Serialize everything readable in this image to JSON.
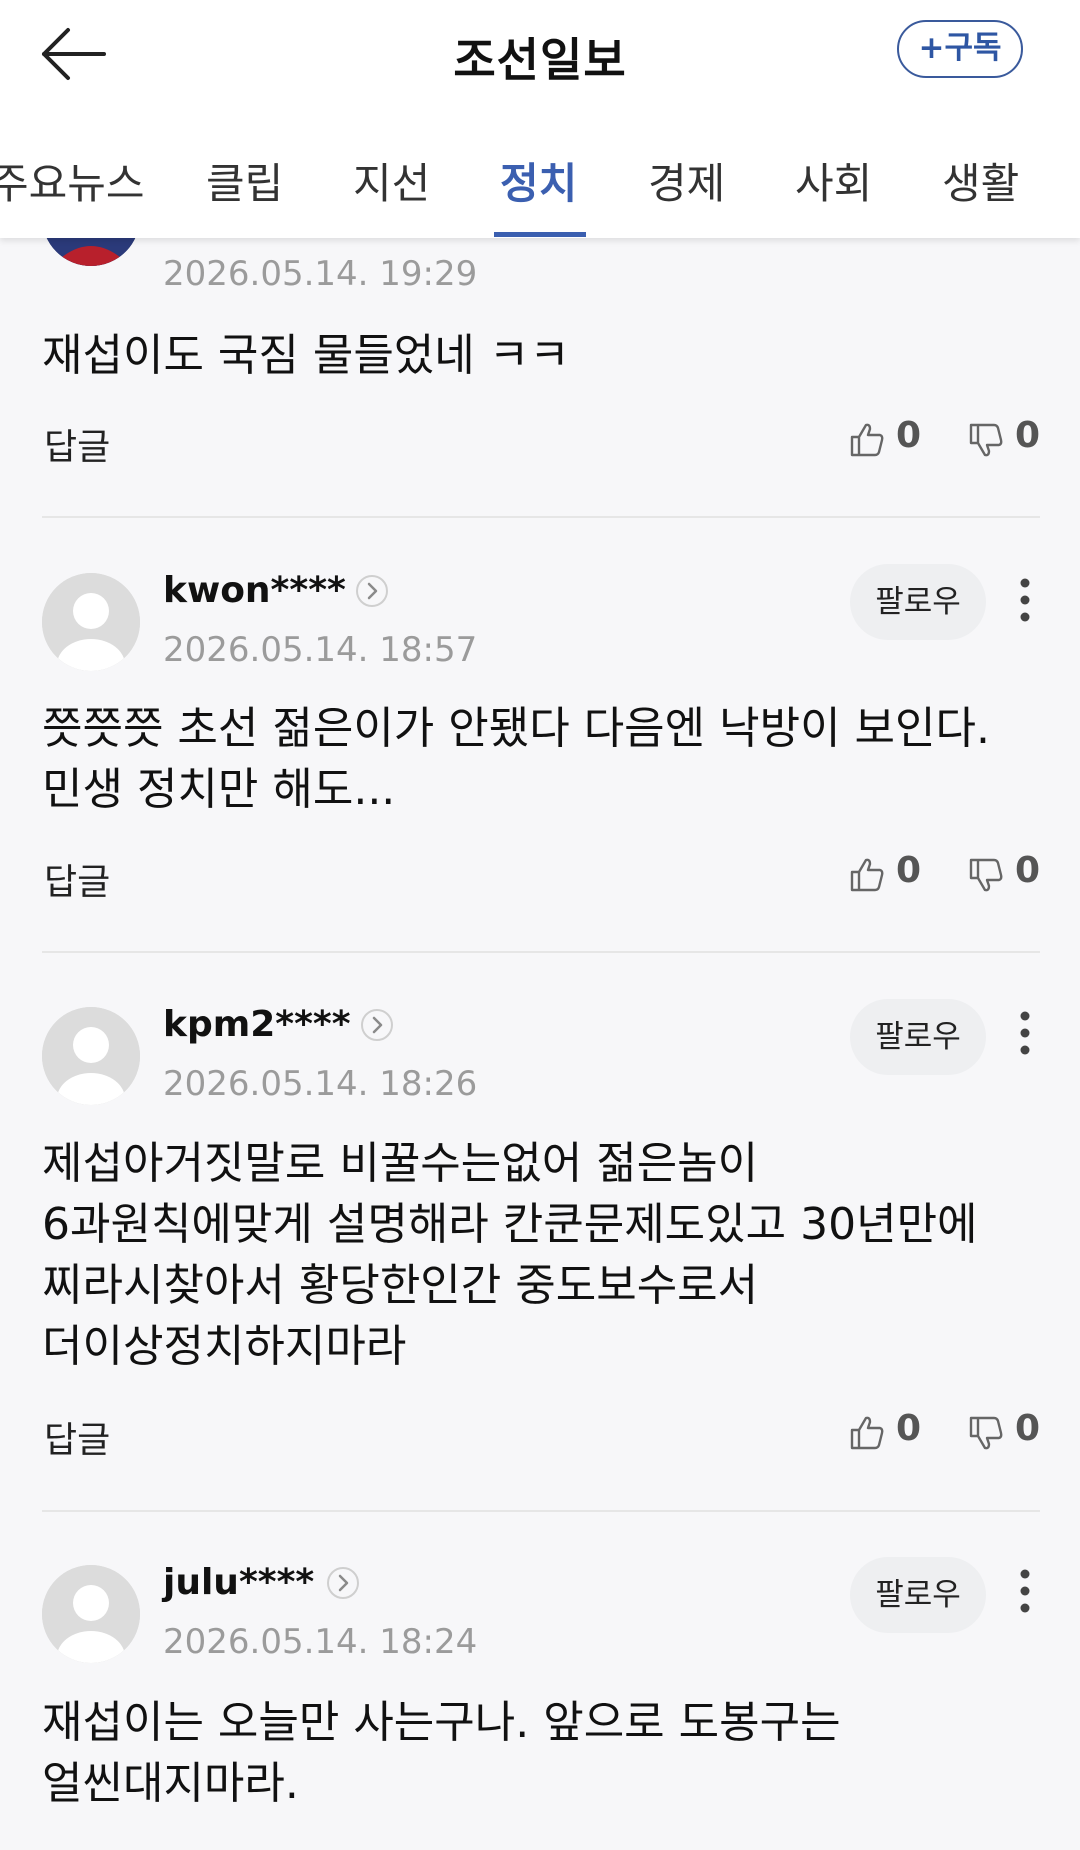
{
  "header": {
    "title": "조선일보",
    "subscribe_label": "+구독"
  },
  "tabs": [
    "주요뉴스",
    "클립",
    "지선",
    "정치",
    "경제",
    "사회",
    "생활"
  ],
  "active_tab": "정치",
  "comments": [
    {
      "username": "",
      "timestamp": "2026.05.14. 19:29",
      "text": "재섭이도 국짐 물들었네 ㅋㅋ",
      "reply_label": "답글",
      "likes": "0",
      "dislikes": "0"
    },
    {
      "username": "kwon****",
      "timestamp": "2026.05.14. 18:57",
      "text": "쯧쯧쯧 초선 젊은이가 안됐다 다음엔 낙방이 보인다. 민생 정치만 해도...",
      "follow_label": "팔로우",
      "reply_label": "답글",
      "likes": "0",
      "dislikes": "0"
    },
    {
      "username": "kpm2****",
      "timestamp": "2026.05.14. 18:26",
      "text": "제섭아거짓말로 비꿀수는없어 젊은놈이 6과원칙에맞게 설명해라 칸쿤문제도있고 30년만에 찌라시찾아서 황당한인간 중도보수로서 더이상정치하지마라",
      "follow_label": "팔로우",
      "reply_label": "답글",
      "likes": "0",
      "dislikes": "0"
    },
    {
      "username": "julu****",
      "timestamp": "2026.05.14. 18:24",
      "text": "재섭이는 오늘만 사는구나. 앞으로 도봉구는 얼씬대지마라.",
      "follow_label": "팔로우"
    }
  ],
  "colors": {
    "accent": "#3b5fb0",
    "timestamp": "#9b9b9b",
    "background": "#f7f7f9"
  }
}
